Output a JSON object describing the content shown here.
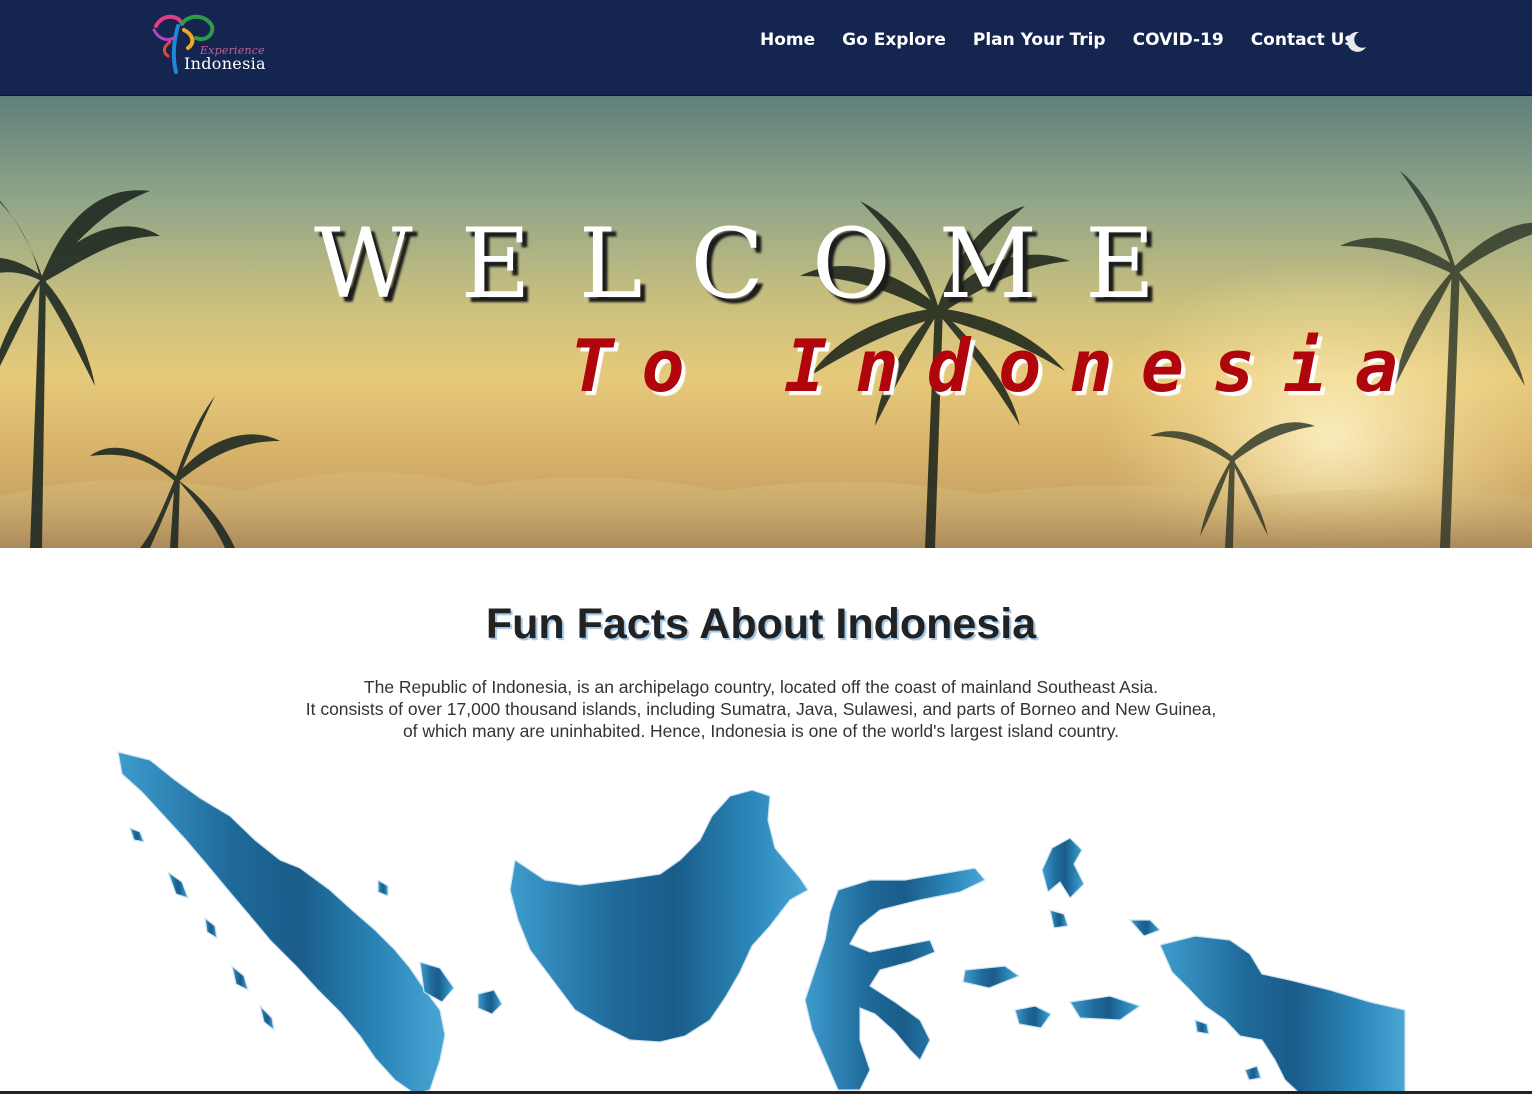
{
  "navbar": {
    "logo": {
      "small": "Experience",
      "big": "Indonesia"
    },
    "links": [
      "Home",
      "Go Explore",
      "Plan Your Trip",
      "COVID-19",
      "Contact Us"
    ],
    "theme_toggle_icon": "moon-icon"
  },
  "hero": {
    "welcome": "WELCOME",
    "subtitle": "To Indonesia"
  },
  "fun_facts": {
    "title": "Fun Facts About Indonesia",
    "lines": [
      "The Republic of Indonesia, is an archipelago country, located off the coast of mainland Southeast Asia.",
      "It consists of over 17,000 thousand islands, including Sumatra, Java, Sulawesi, and parts of Borneo and New Guinea,",
      "of which many are uninhabited. Hence, Indonesia is one of the world's largest island country."
    ]
  },
  "colors": {
    "navbar": "#14254f",
    "subtitle": "#b0050c",
    "map_light": "#3d9ccd",
    "map_dark": "#1a5c8a"
  }
}
